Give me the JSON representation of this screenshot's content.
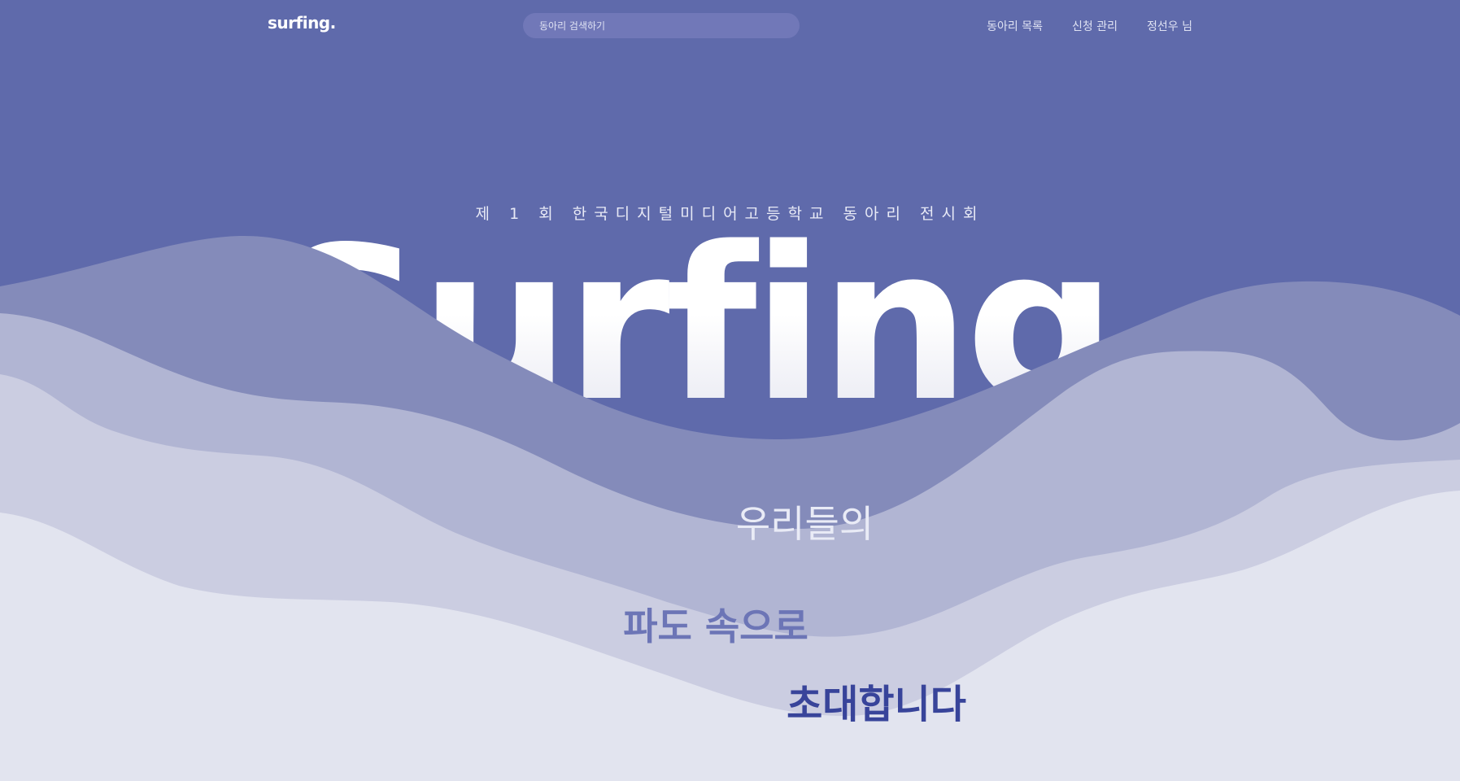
{
  "header": {
    "logo": "surfing.",
    "search_placeholder": "동아리 검색하기",
    "nav": [
      {
        "label": "동아리 목록"
      },
      {
        "label": "신청 관리"
      },
      {
        "label": "정선우 님"
      }
    ]
  },
  "hero": {
    "subtitle": "제 1 회 한국디지털미디어고등학교 동아리 전시회",
    "title": "Surfing.",
    "line1": "우리들의",
    "line2": "파도 속으로",
    "line3": "초대합니다"
  },
  "colors": {
    "background": "#5f6aab",
    "wave1": "#848bba",
    "wave2": "#b1b5d3",
    "wave3": "#cbcde1",
    "wave4": "#e2e4ef",
    "accent_dark": "#38449a"
  }
}
